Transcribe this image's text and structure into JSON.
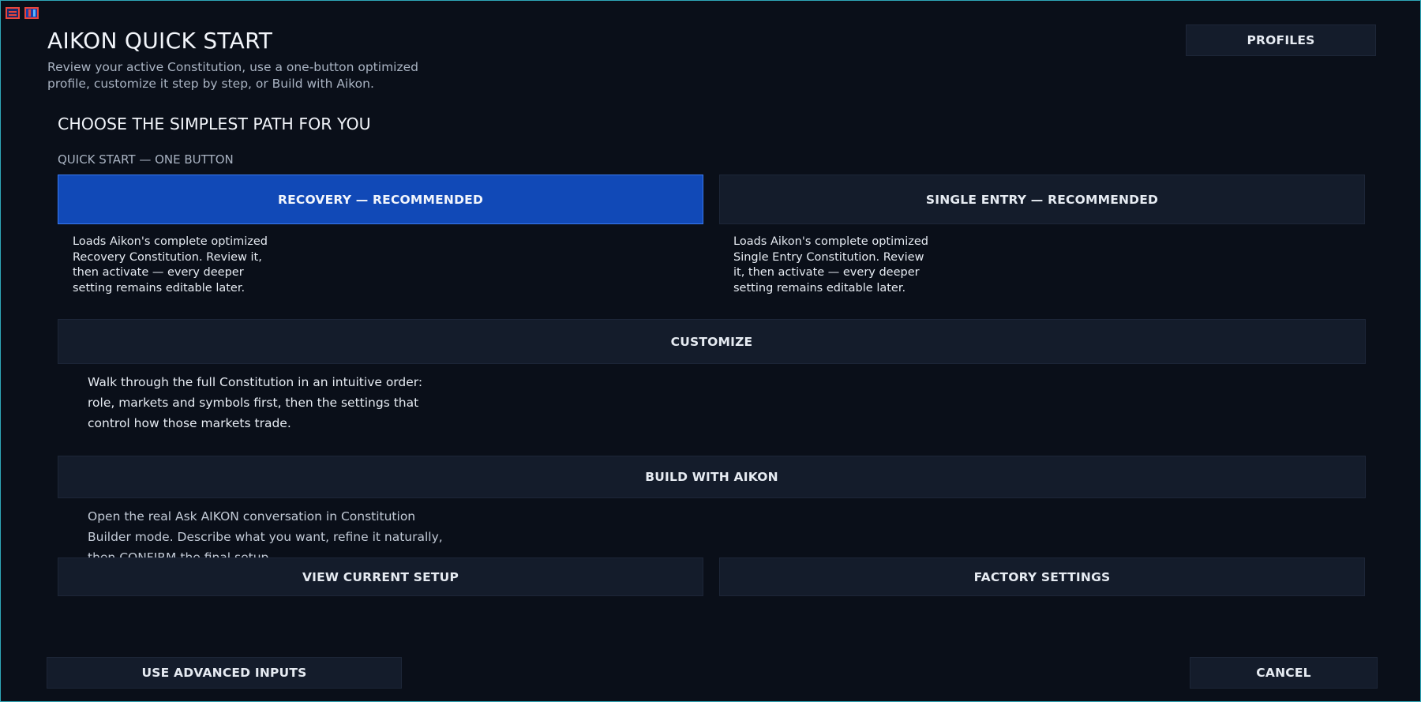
{
  "header": {
    "title": "AIKON QUICK START",
    "subtitle": "Review your active Constitution, use a one-button optimized profile, customize it step by step, or Build with Aikon.",
    "profiles_label": "PROFILES"
  },
  "section": {
    "heading": "CHOOSE THE SIMPLEST PATH FOR YOU",
    "sublabel": "QUICK START — ONE BUTTON"
  },
  "recovery": {
    "label": "RECOVERY — RECOMMENDED",
    "description": "Loads Aikon's complete optimized Recovery Constitution. Review it, then activate — every deeper setting remains editable later."
  },
  "single_entry": {
    "label": "SINGLE ENTRY — RECOMMENDED",
    "description": "Loads Aikon's complete optimized Single Entry Constitution. Review it, then activate — every deeper setting remains editable later."
  },
  "customize": {
    "label": "CUSTOMIZE",
    "description": "Walk through the full Constitution in an intuitive order: role, markets and symbols first, then the settings that control how those markets trade."
  },
  "build": {
    "label": "BUILD WITH AIKON",
    "description": "Open the real Ask AIKON conversation in Constitution Builder mode. Describe what you want, refine it naturally, then CONFIRM the final setup."
  },
  "view_current_label": "VIEW CURRENT SETUP",
  "factory_settings_label": "FACTORY SETTINGS",
  "footer": {
    "advanced_label": "USE ADVANCED INPUTS",
    "cancel_label": "CANCEL"
  },
  "colors": {
    "background": "#0a0f19",
    "button": "#141c2b",
    "primary": "#1149b7",
    "border_accent": "#2fa7b8"
  }
}
